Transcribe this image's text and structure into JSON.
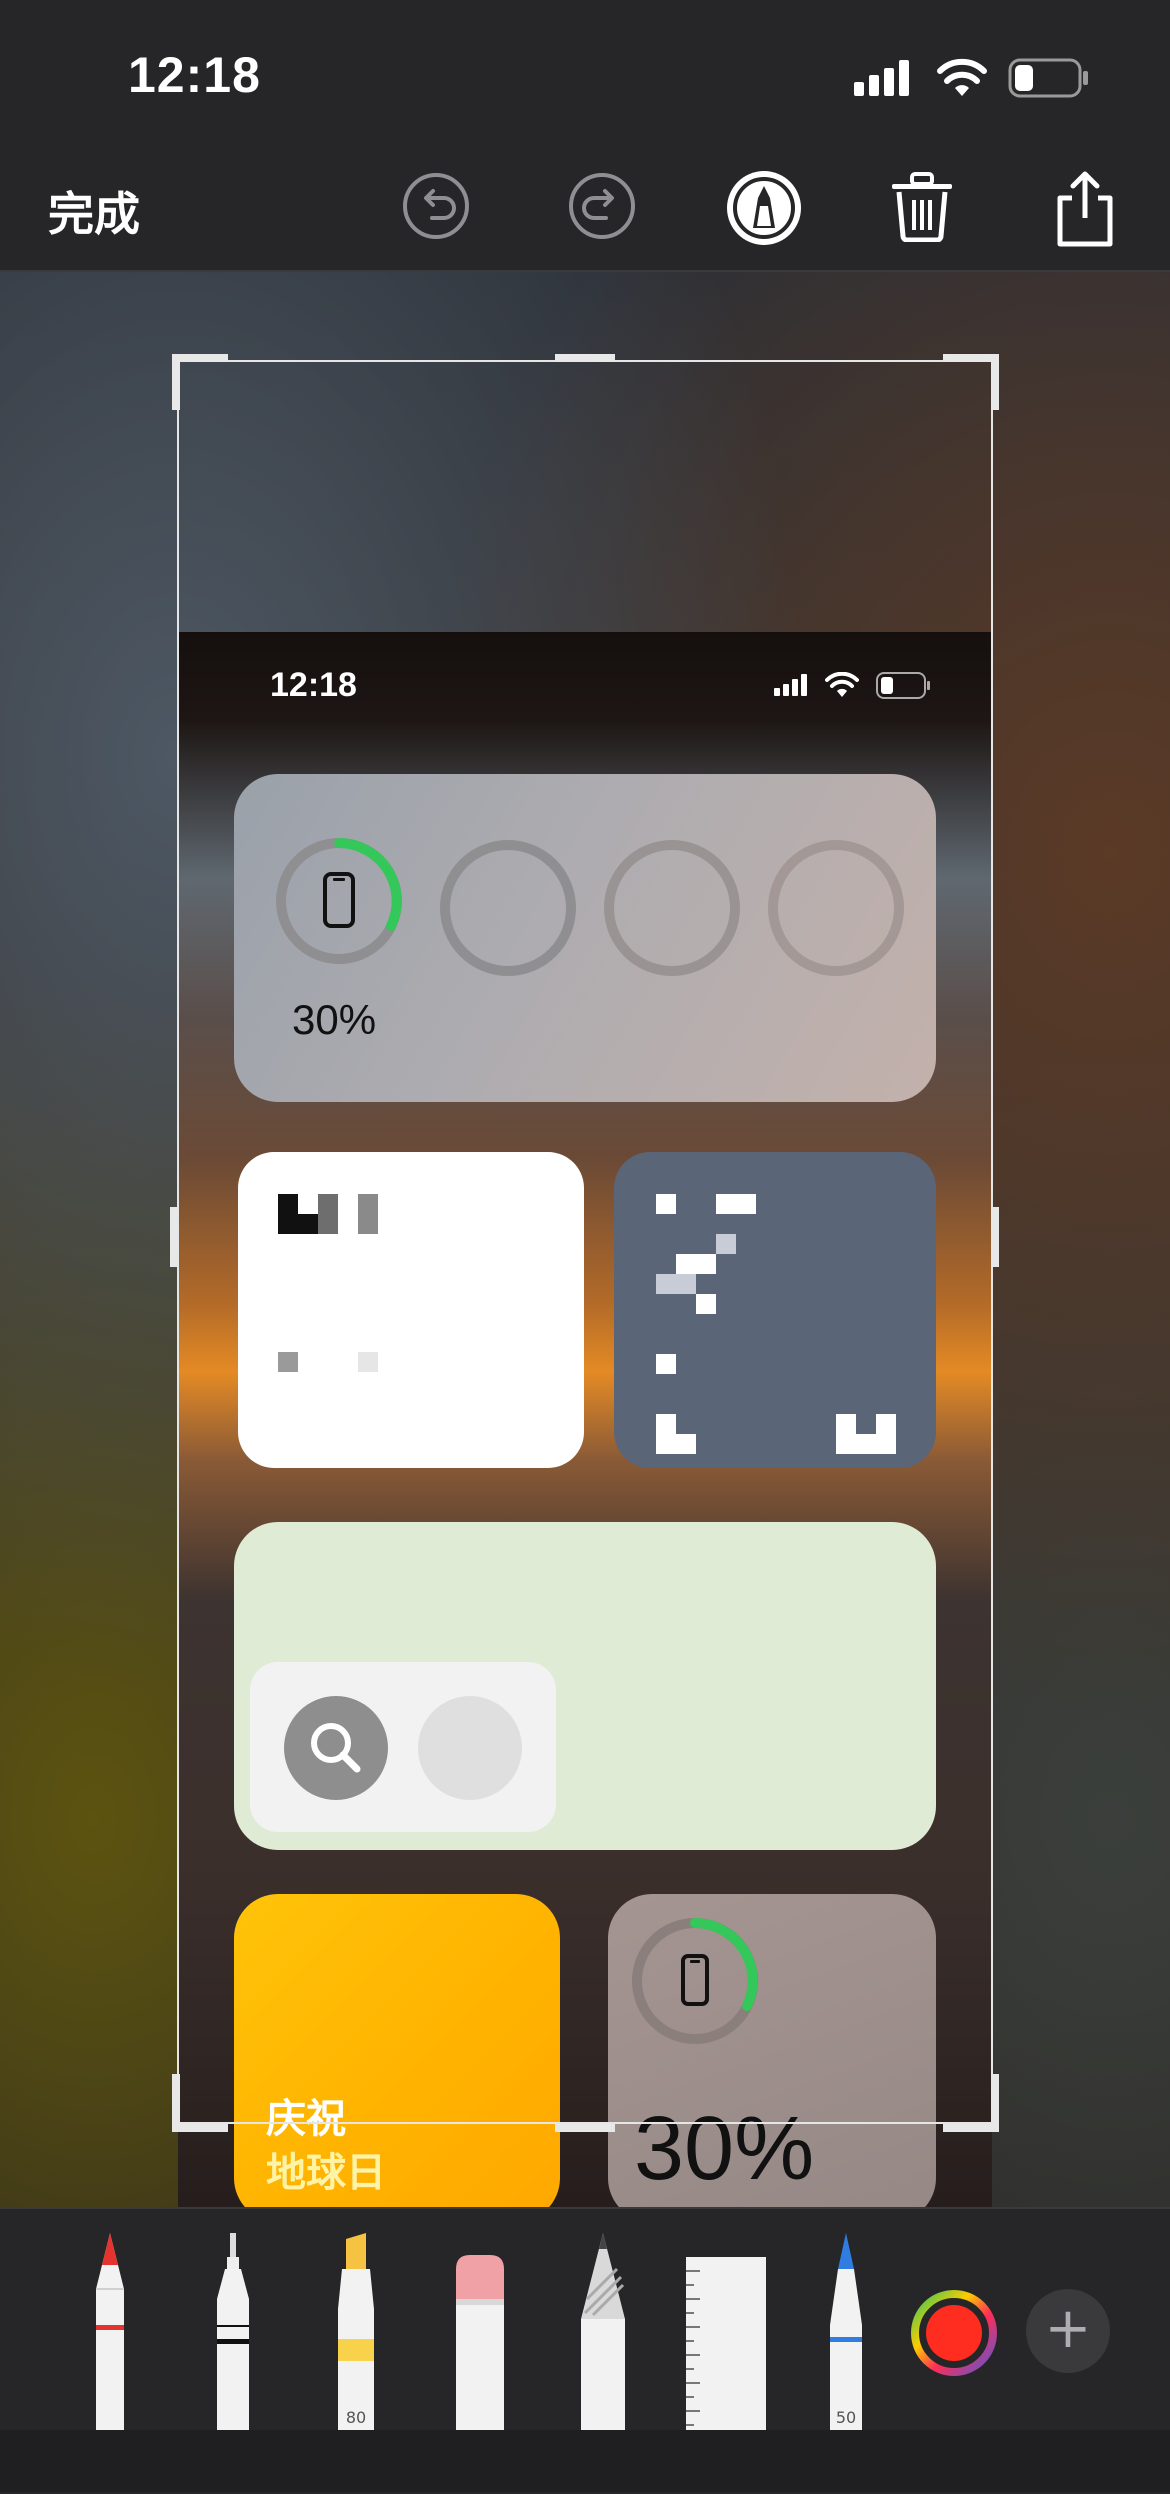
{
  "device_status": {
    "time": "12:18"
  },
  "toolbar": {
    "done_label": "完成",
    "undo_icon": "undo-icon",
    "redo_icon": "redo-icon",
    "markup_icon": "markup-pen-icon",
    "delete_icon": "trash-icon",
    "share_icon": "share-icon"
  },
  "screenshot": {
    "status_time": "12:18",
    "battery_widget": {
      "percent": "30%"
    },
    "earth_day_widget": {
      "line1": "庆祝",
      "line2": "地球日"
    },
    "battery_small_widget": {
      "percent": "30%"
    }
  },
  "tools": {
    "pen": {
      "name": "pen-tool"
    },
    "fineliner": {
      "name": "fineliner-tool"
    },
    "highlighter": {
      "name": "highlighter-tool",
      "size": "80"
    },
    "eraser": {
      "name": "eraser-tool"
    },
    "pencil": {
      "name": "pencil-tool"
    },
    "ruler": {
      "name": "ruler-tool"
    },
    "crayon": {
      "name": "crayon-tool",
      "size": "50"
    },
    "color": {
      "value": "#ff2d20"
    },
    "add_label": "+"
  },
  "colors": {
    "accent_green": "#34c759",
    "selected_color": "#ff2d20",
    "earth_day_text": "#fff3a6"
  }
}
